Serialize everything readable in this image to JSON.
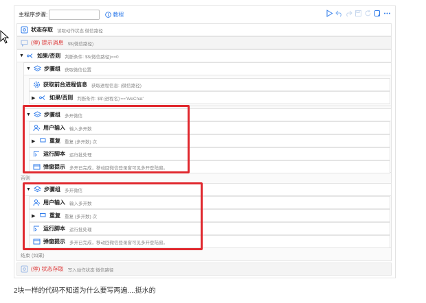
{
  "toolbar": {
    "step_label": "主程序步骤:",
    "step_input_value": "",
    "help_label": "教程"
  },
  "steps": {
    "save_state_top": {
      "name": "状态存取",
      "desc": "读取动作状态  微信路径"
    },
    "disabled_prompt": {
      "name": "(停) 提示消息",
      "desc": "$$(微信路径)"
    },
    "if_else": {
      "name": "如果/否则",
      "desc": "判断条件: $$(微信路径)==0"
    },
    "group1": {
      "name": "步骤组",
      "desc": "获取微信位置"
    },
    "get_process": {
      "name": "获取前台进程信息",
      "desc": "获取进程信息: (微信路径)"
    },
    "nested_if": {
      "name": "如果/否则",
      "desc": "判断条件: $$'(进程名)'=='WeChat'"
    },
    "group_a": {
      "name": "步骤组",
      "desc": "多开微信"
    },
    "user_input_a": {
      "name": "用户输入",
      "desc": "输入多开数"
    },
    "repeat_a": {
      "name": "重复",
      "desc": "重复 (多开数) 次"
    },
    "run_script_a": {
      "name": "运行脚本",
      "desc": "运行批处理"
    },
    "popup_a": {
      "name": "弹窗提示",
      "desc": "多开已完成，移动回微信登录窗可见多开登陆窗。"
    },
    "else_label": "否则",
    "group_b": {
      "name": "步骤组",
      "desc": "多开微信"
    },
    "user_input_b": {
      "name": "用户输入",
      "desc": "输入多开数"
    },
    "repeat_b": {
      "name": "重复",
      "desc": "重复 (多开数) 次"
    },
    "run_script_b": {
      "name": "运行脚本",
      "desc": "运行批处理"
    },
    "popup_b": {
      "name": "弹窗提示",
      "desc": "多开已完成，移动回微信登录窗可见多开登陆窗。"
    },
    "end_if_label": "结束 (如果)",
    "save_state_bottom": {
      "name": "(停) 状态存取",
      "desc": "写入动作状态  微信路径"
    }
  },
  "caption": "2块一样的代码不知道为什么要写两遍....挺水的",
  "colors": {
    "accent": "#2f7bea",
    "highlight": "#e0282e",
    "disabled_text": "#d33"
  },
  "icons": [
    "cursor-arrow-icon",
    "info-icon",
    "run-icon",
    "undo-icon",
    "redo-icon",
    "save-icon",
    "refresh-icon",
    "copy-icon",
    "more-icon",
    "gear-icon",
    "branch-icon",
    "layers-icon",
    "user-icon",
    "repeat-icon",
    "script-icon",
    "window-icon"
  ]
}
